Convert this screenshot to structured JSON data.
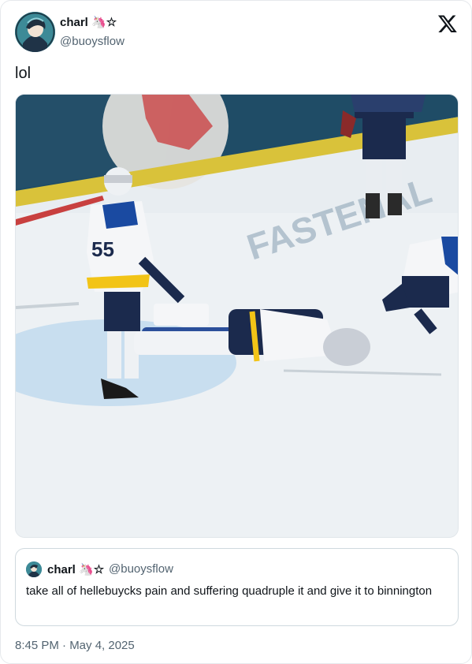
{
  "author": {
    "display_name": "charl 🦄☆",
    "handle": "@buoysflow"
  },
  "tweet": {
    "text": "lol",
    "timestamp": "8:45 PM · May 4, 2025"
  },
  "media": {
    "rink_ad_text": "FASTENAL",
    "jersey_number": "55"
  },
  "quoted_tweet": {
    "display_name": "charl 🦄☆",
    "handle": "@buoysflow",
    "text": "take all of hellebuycks pain and suffering quadruple it and give it to binnington"
  },
  "icons": {
    "brand": "x-logo-icon"
  },
  "colors": {
    "text_primary": "#0f1419",
    "text_secondary": "#536471",
    "border": "#cfd9de"
  }
}
